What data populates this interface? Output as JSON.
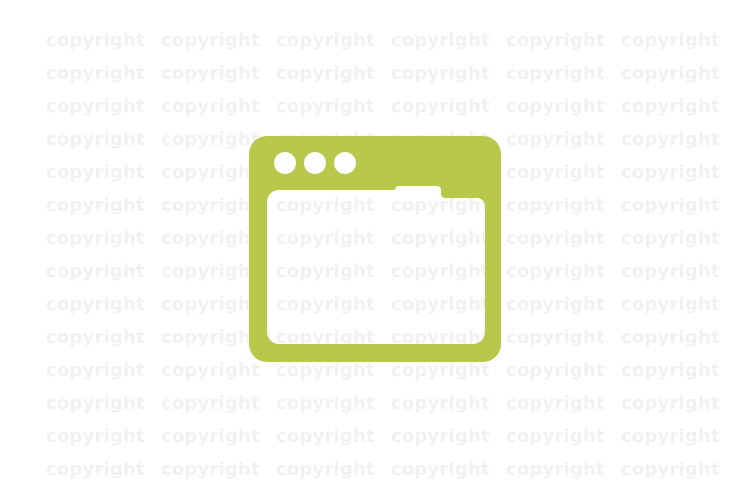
{
  "watermark": {
    "text": "copyright"
  },
  "icon": {
    "name": "browser-window-icon",
    "color": "#b8c84a"
  },
  "background_color": "#ffffff"
}
